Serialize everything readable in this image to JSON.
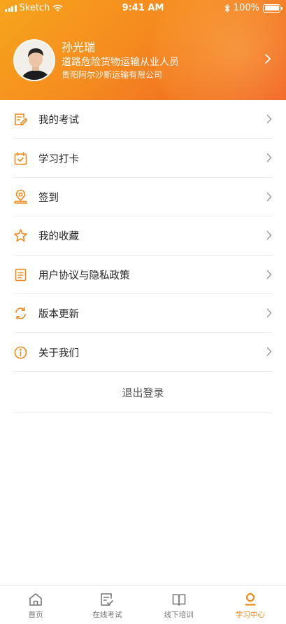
{
  "status_bar": {
    "carrier": "Sketch",
    "time": "9:41 AM",
    "battery": "100%"
  },
  "profile": {
    "name": "孙光瑞",
    "role": "道路危险货物运输从业人员",
    "company": "贵阳阿尔沙斯运输有限公司"
  },
  "menu": {
    "items": [
      {
        "label": "我的考试",
        "icon": "exam-edit-icon"
      },
      {
        "label": "学习打卡",
        "icon": "calendar-check-icon"
      },
      {
        "label": "签到",
        "icon": "location-pin-icon"
      },
      {
        "label": "我的收藏",
        "icon": "star-icon"
      },
      {
        "label": "用户协议与隐私政策",
        "icon": "document-icon"
      },
      {
        "label": "版本更新",
        "icon": "refresh-icon"
      },
      {
        "label": "关于我们",
        "icon": "info-icon"
      }
    ]
  },
  "logout_label": "退出登录",
  "tabbar": {
    "tabs": [
      {
        "label": "首页",
        "icon": "home-icon",
        "active": false
      },
      {
        "label": "在线考试",
        "icon": "online-exam-icon",
        "active": false
      },
      {
        "label": "线下培训",
        "icon": "book-icon",
        "active": false
      },
      {
        "label": "学习中心",
        "icon": "user-center-icon",
        "active": true
      }
    ]
  },
  "colors": {
    "accent": "#f08a1c",
    "header_start": "#f7a51c",
    "header_end": "#f05a22"
  }
}
